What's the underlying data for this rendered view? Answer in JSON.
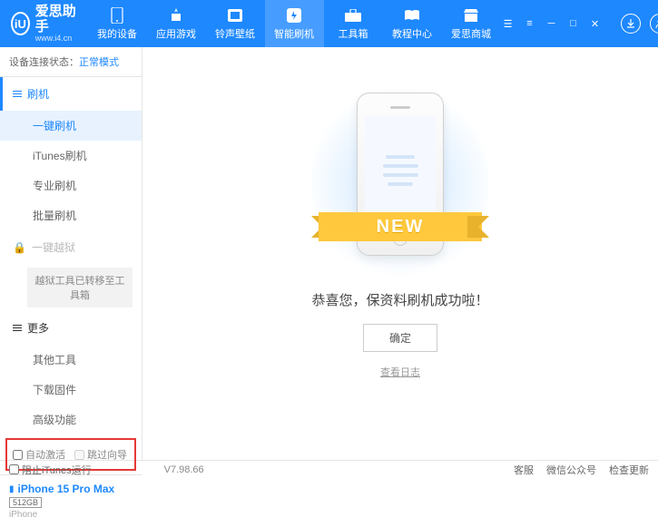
{
  "header": {
    "logo_letter": "iU",
    "logo_text": "爱思助手",
    "logo_sub": "www.i4.cn",
    "nav": [
      {
        "label": "我的设备"
      },
      {
        "label": "应用游戏"
      },
      {
        "label": "铃声壁纸"
      },
      {
        "label": "智能刷机"
      },
      {
        "label": "工具箱"
      },
      {
        "label": "教程中心"
      },
      {
        "label": "爱思商城"
      }
    ]
  },
  "sidebar": {
    "status_label": "设备连接状态：",
    "status_mode": "正常模式",
    "flash_header": "刷机",
    "items": [
      {
        "label": "一键刷机"
      },
      {
        "label": "iTunes刷机"
      },
      {
        "label": "专业刷机"
      },
      {
        "label": "批量刷机"
      }
    ],
    "jailbreak_header": "一键越狱",
    "jailbreak_note": "越狱工具已转移至工具箱",
    "more_header": "更多",
    "more_items": [
      {
        "label": "其他工具"
      },
      {
        "label": "下载固件"
      },
      {
        "label": "高级功能"
      }
    ],
    "auto_activate": "自动激活",
    "skip_guide": "跳过向导",
    "device_name": "iPhone 15 Pro Max",
    "device_storage": "512GB",
    "device_type": "iPhone"
  },
  "main": {
    "banner_text": "NEW",
    "success_msg": "恭喜您，保资料刷机成功啦！",
    "ok_btn": "确定",
    "log_link": "查看日志"
  },
  "footer": {
    "block_itunes": "阻止iTunes运行",
    "version": "V7.98.66",
    "links": [
      "客服",
      "微信公众号",
      "检查更新"
    ]
  }
}
